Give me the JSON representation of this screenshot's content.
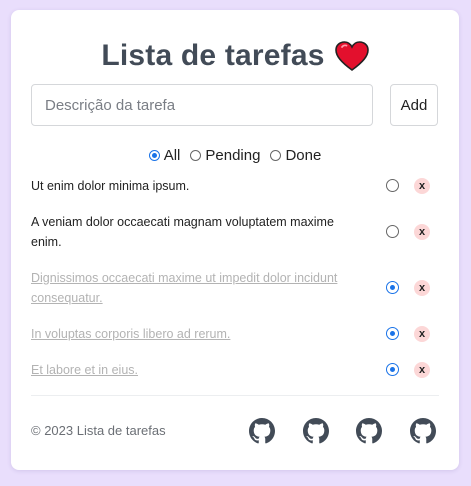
{
  "header": {
    "title": "Lista de tarefas",
    "title_icon": "heart-icon"
  },
  "form": {
    "placeholder": "Descrição da tarefa",
    "add_label": "Add"
  },
  "filters": [
    {
      "label": "All",
      "selected": true
    },
    {
      "label": "Pending",
      "selected": false
    },
    {
      "label": "Done",
      "selected": false
    }
  ],
  "tasks": [
    {
      "text": "Ut enim dolor minima ipsum.",
      "done": false
    },
    {
      "text": "A veniam dolor occaecati magnam voluptatem maxime enim.",
      "done": false
    },
    {
      "text": "Dignissimos occaecati maxime ut impedit dolor incidunt consequatur.",
      "done": true
    },
    {
      "text": "In voluptas corporis libero ad rerum.",
      "done": true
    },
    {
      "text": "Et labore et in eius.",
      "done": true
    }
  ],
  "delete_label": "x",
  "footer": {
    "copyright": "© 2023 Lista de tarefas",
    "icons": [
      "github-icon",
      "github-icon",
      "github-icon",
      "github-icon"
    ]
  },
  "colors": {
    "background": "#e9defc",
    "accent": "#1a73e8",
    "heart": "#e3102d",
    "delete_bg": "#fcd7d7"
  }
}
